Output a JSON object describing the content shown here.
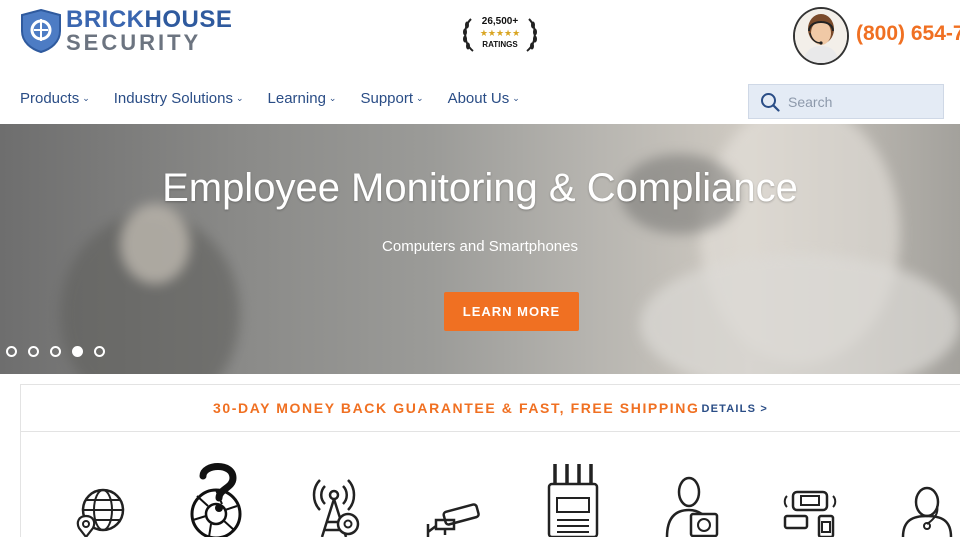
{
  "header": {
    "logo": {
      "line1_a": "BRICK",
      "line1_b": "HOUSE",
      "line2": "SECURITY"
    },
    "ratings": {
      "count": "26,500+",
      "stars": "★★★★★",
      "label": "RATINGS"
    },
    "phone": "(800) 654-7",
    "nav": [
      {
        "label": "Products"
      },
      {
        "label": "Industry Solutions"
      },
      {
        "label": "Learning"
      },
      {
        "label": "Support"
      },
      {
        "label": "About Us"
      }
    ],
    "search": {
      "placeholder": "Search",
      "value": ""
    }
  },
  "hero": {
    "title": "Employee Monitoring & Compliance",
    "subtitle": "Computers and Smartphones",
    "button": "LEARN MORE",
    "slides": 5,
    "active_slide": 4
  },
  "guarantee": {
    "text": "30-DAY MONEY BACK GUARANTEE & FAST, FREE SHIPPING",
    "link": "DETAILS >"
  },
  "categories": [
    {
      "icon": "globe-location-icon"
    },
    {
      "icon": "question-camera-lens-icon"
    },
    {
      "icon": "signal-tower-icon"
    },
    {
      "icon": "security-camera-icon"
    },
    {
      "icon": "signal-jammer-icon"
    },
    {
      "icon": "person-device-icon"
    },
    {
      "icon": "wireless-devices-icon"
    },
    {
      "icon": "person-earpiece-icon"
    }
  ],
  "colors": {
    "brand_blue": "#2a4d86",
    "accent_orange": "#f07022",
    "search_bg": "#e4ebf5"
  }
}
